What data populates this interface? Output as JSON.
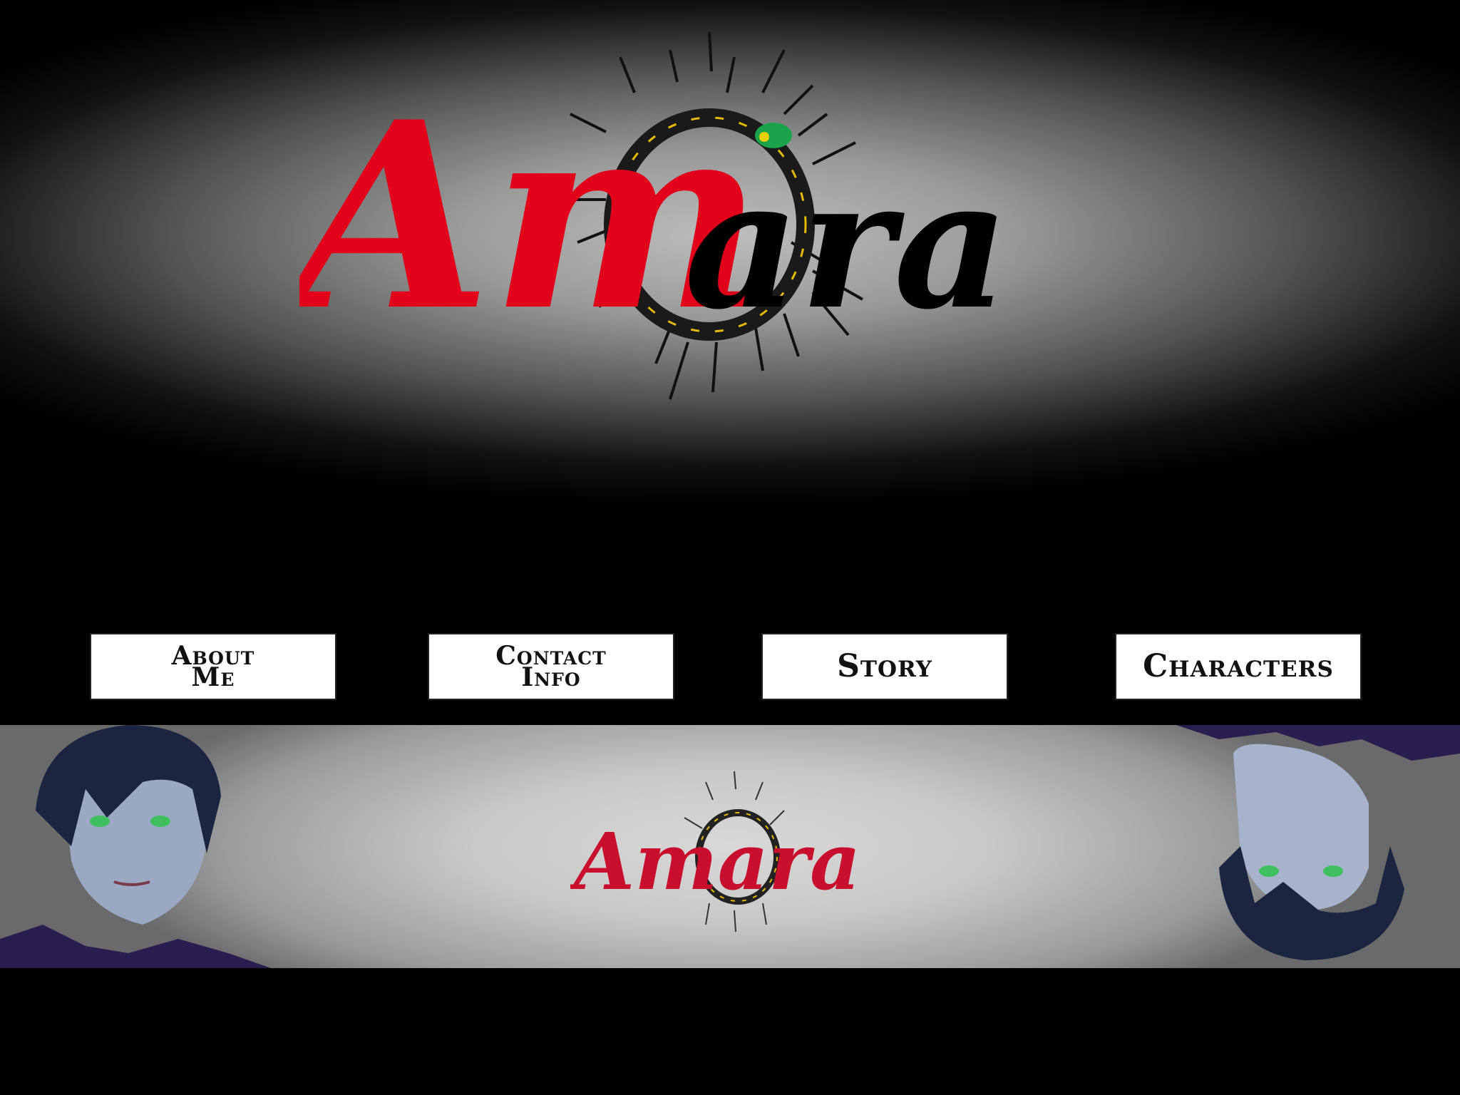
{
  "hero": {
    "logo_text": "Amara",
    "logo_split": {
      "red_part": "Am",
      "black_part": "ara"
    }
  },
  "nav": {
    "items": [
      {
        "line1": "About",
        "line2": "Me"
      },
      {
        "line1": "Contact",
        "line2": "Info"
      },
      {
        "label": "Story"
      },
      {
        "label": "Characters"
      }
    ]
  },
  "banner": {
    "logo_text": "Amara"
  },
  "colors": {
    "logo_red": "#e3001b",
    "logo_black": "#000000",
    "ring_gold": "#e6b800",
    "gem_green": "#1aa34a",
    "button_bg": "#ffffff",
    "page_bg": "#000000"
  }
}
